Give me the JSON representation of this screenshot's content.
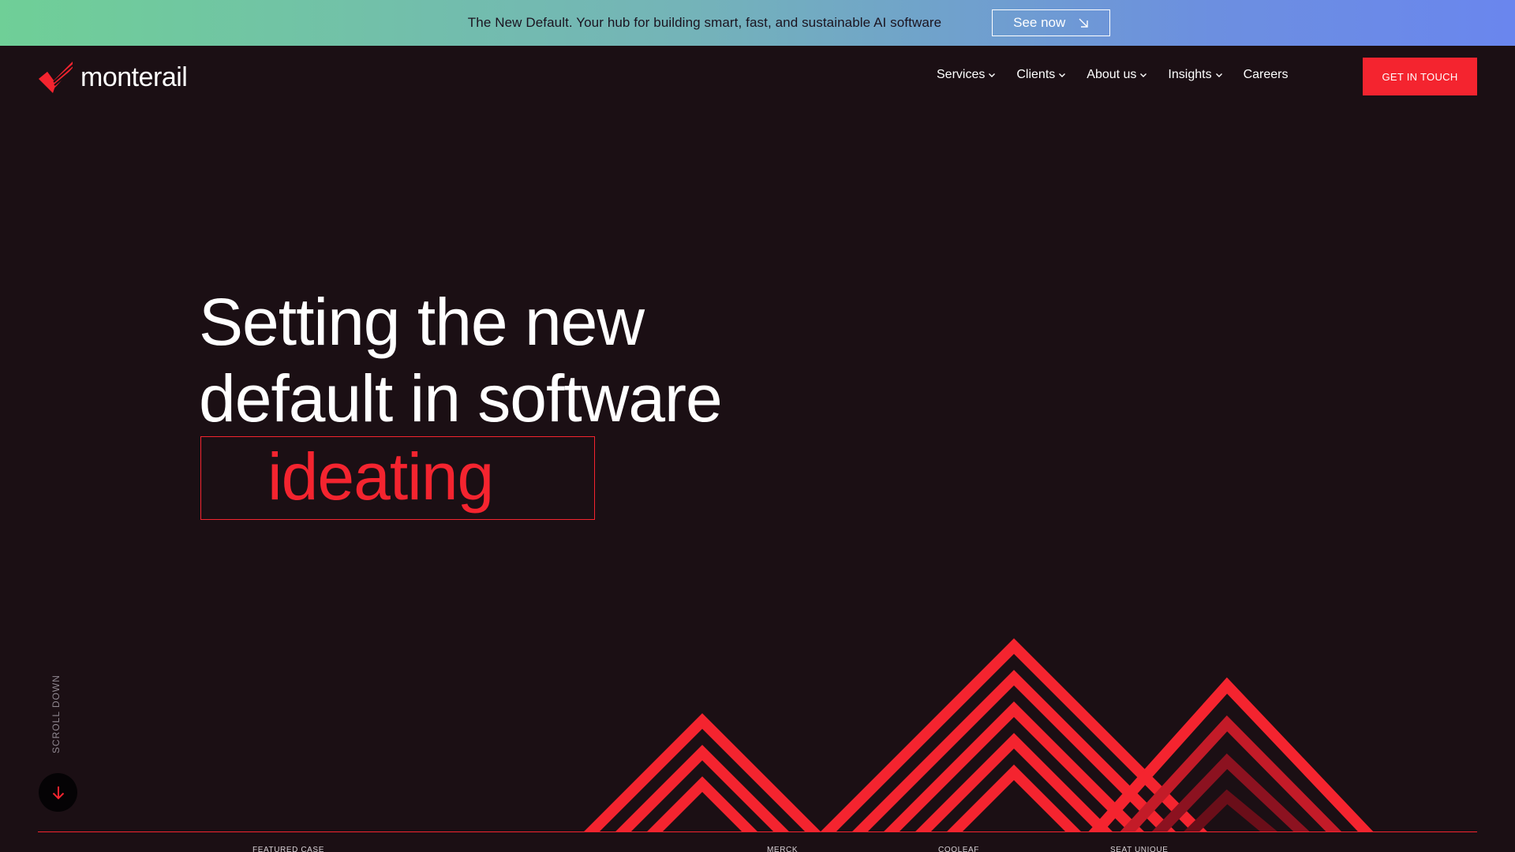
{
  "banner": {
    "text": "The New Default. Your hub for building smart, fast, and sustainable AI software",
    "button_label": "See now"
  },
  "header": {
    "logo_text": "monterail",
    "nav": [
      {
        "label": "Services",
        "has_dropdown": true
      },
      {
        "label": "Clients",
        "has_dropdown": true
      },
      {
        "label": "About us",
        "has_dropdown": true
      },
      {
        "label": "Insights",
        "has_dropdown": true
      },
      {
        "label": "Careers",
        "has_dropdown": false
      }
    ],
    "cta_label": "GET IN TOUCH"
  },
  "hero": {
    "title_line1": "Setting the new",
    "title_line2": "default in software",
    "rotating_word": "ideating"
  },
  "scroll": {
    "label": "SCROLL DOWN"
  },
  "bottom_strip": {
    "labels": [
      "FEATURED CASE",
      "MERCK",
      "COOLEAF",
      "SEAT UNIQUE"
    ]
  },
  "colors": {
    "background": "#1b0f14",
    "accent": "#f4242f",
    "accent_dark": "#a01421",
    "banner_gradient_start": "#6fcf97",
    "banner_gradient_end": "#6a86ee"
  },
  "icons": {
    "banner_button": "arrow-down-right-icon",
    "nav_dropdown": "chevron-down-icon",
    "scroll": "arrow-down-icon",
    "logo": "monterail-bird-logo-icon"
  }
}
